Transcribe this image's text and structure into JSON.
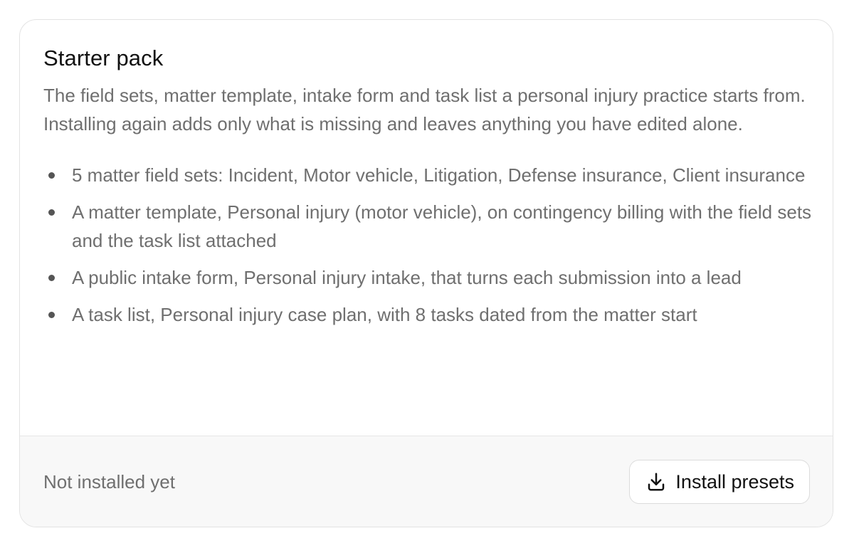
{
  "card": {
    "title": "Starter pack",
    "description": "The field sets, matter template, intake form and task list a personal injury practice starts from. Installing again adds only what is missing and leaves anything you have edited alone.",
    "items": [
      "5 matter field sets: Incident, Motor vehicle, Litigation, Defense insurance, Client insurance",
      "A matter template, Personal injury (motor vehicle), on contingency billing with the field sets and the task list attached",
      "A public intake form, Personal injury intake, that turns each submission into a lead",
      "A task list, Personal injury case plan, with 8 tasks dated from the matter start"
    ]
  },
  "footer": {
    "status": "Not installed yet",
    "install_label": "Install presets",
    "install_icon": "download-icon"
  }
}
